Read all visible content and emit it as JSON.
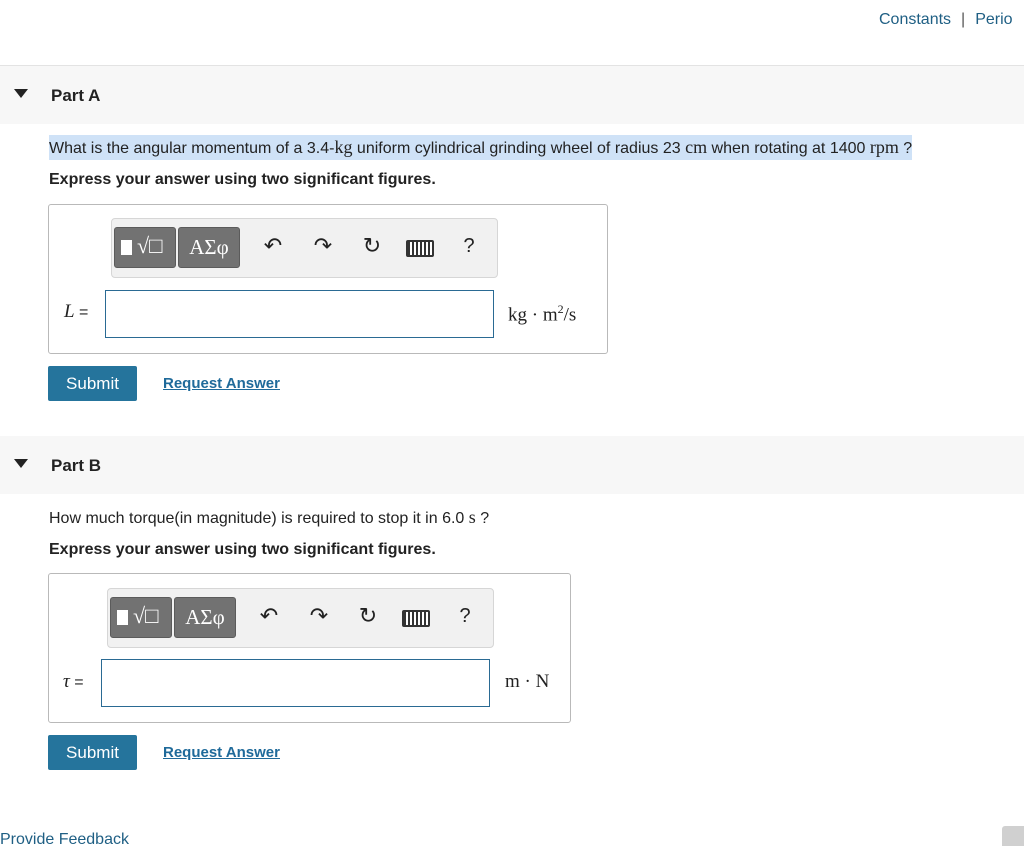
{
  "top_links": {
    "constants": "Constants",
    "separator": "|",
    "periodic": "Perio"
  },
  "part_a": {
    "title": "Part A",
    "question": {
      "pre": "What is the angular momentum of a 3.4-",
      "unit_kg": "kg",
      "mid": " uniform cylindrical grinding wheel of radius 23 ",
      "unit_cm": "cm",
      "mid2": " when rotating at 1400 ",
      "unit_rpm": "rpm",
      "end": " ?"
    },
    "instruction": "Express your answer using two significant figures.",
    "variable": "L",
    "equals": "=",
    "units": "kg · m",
    "units_exp": "2",
    "units_tail": "/s",
    "greek_label": "ΑΣφ",
    "help_label": "?",
    "submit_label": "Submit",
    "request_label": "Request Answer"
  },
  "part_b": {
    "title": "Part B",
    "question": {
      "pre": "How much torque(in magnitude) is required to stop it in 6.0 ",
      "unit_s": "s",
      "end": " ?"
    },
    "instruction": "Express your answer using two significant figures.",
    "variable": "τ",
    "equals": "=",
    "units": "m · N",
    "greek_label": "ΑΣφ",
    "help_label": "?",
    "submit_label": "Submit",
    "request_label": "Request Answer"
  },
  "feedback_link": "Provide Feedback"
}
